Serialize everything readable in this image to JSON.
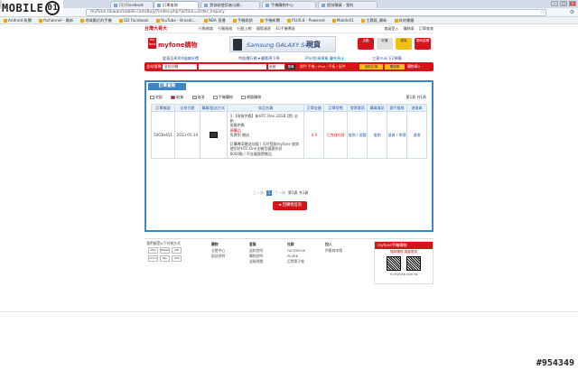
{
  "watermark": {
    "brand": "MOBILE",
    "brand_icon": "01",
    "id": "#954349"
  },
  "browser": {
    "tabs": [
      {
        "label": "Android 新聞中文..."
      },
      {
        "label": "(1) Facebook"
      },
      {
        "label": "訂單查詢"
      },
      {
        "label": "我協助使用者公開..."
      },
      {
        "label": "手機購物中心"
      },
      {
        "label": "提前購買 - 我的"
      }
    ],
    "active_tab": 2,
    "url": "myfone.taiwanmobile.com/buy/?index.php?action=order_inquiry",
    "bookmarks": [
      "Android 新聞",
      "fschannel - 最新",
      "地域最近的手機",
      "GD Facebook",
      "YouTube - Broadc...",
      "NBA 直播",
      "手機熱銷",
      "手機新聞",
      "PLUS.8 - Powered",
      "Mobile01",
      "主題區_最新",
      "其他書籤"
    ],
    "nav": {
      "back": "◀",
      "forward": "▶",
      "reload": "↻",
      "home": "⌂"
    }
  },
  "site": {
    "top_logo": "台灣大哥大",
    "top_links": [
      "行動網路",
      "行動服務",
      "行動上網",
      "國際漫遊",
      "4G手機專區"
    ],
    "top_right": [
      "會員登入",
      "購物車",
      "訂單查詢"
    ],
    "brand_name": "myfone購物",
    "ad": {
      "text": "Samsung GALAXY S4",
      "tag": "現貨"
    },
    "promos": [
      "活動",
      "好康",
      "優惠",
      "限時搶購"
    ],
    "marquee": [
      "愛瘋吾8000抽拿好禮",
      "特殺價行動★優惠現下降",
      "iPad台灣現貨 優先為止",
      "三星mini下2預購"
    ],
    "search": {
      "label": "全站搜尋",
      "category": "全站分類",
      "scope": "全館",
      "go": "搜尋",
      "hot": "熱門 手機 / iPad / 平板 / 配件",
      "btn1": "我的訂單",
      "btn2": "購物車",
      "cart": "購物車0"
    }
  },
  "orders": {
    "title": "訂單查詢",
    "legend": [
      {
        "label": "宅配",
        "color": "#ffffff"
      },
      {
        "label": "取貨",
        "color": "#d4141b"
      },
      {
        "label": "取消",
        "color": "#dddddd"
      },
      {
        "label": "手機購物",
        "color": "#ffffff"
      },
      {
        "label": "網路購物",
        "color": "#ffffff"
      }
    ],
    "page_top": "第1頁 共1頁",
    "columns": [
      "訂單編號",
      "交易日期",
      "購買/配送方式",
      "商品名稱",
      "訂單金額",
      "訂單狀態",
      "發票資訊",
      "購買資訊",
      "客戶服務",
      "退換貨"
    ],
    "rows": [
      {
        "order_no": "5003H451",
        "date": "2013-05-14",
        "product_lines": [
          "1.【現貨供應】新HTC One 32GB (黑) 全新",
          "限量供應",
          "預購品",
          "免費到 贈送",
          "",
          "訂購專案贈送加值 / 可於登錄myfone 查詢",
          "使用於HTC One全機型優惠折扣",
          "8000點 / 不含優惠價贈品"
        ],
        "amount": "$ 0",
        "status": "已完成付款",
        "invoice": "查詢 / 追蹤",
        "buy_info": "查詢",
        "service": "退貨 / 申請",
        "return": "退換"
      }
    ],
    "pager": {
      "prev": "上一頁",
      "current": "1",
      "next": "下一頁",
      "summary": "第1頁 共1頁"
    },
    "back_button": "◄ 回購物首頁"
  },
  "footer": {
    "pay_title": "我們接受以下付款方式",
    "cards": [
      "VISA",
      "Master",
      "JCB",
      "Union",
      "Pay",
      "ATM"
    ],
    "cols": [
      {
        "title": "購物",
        "items": [
          "全館中心",
          "配送說明"
        ]
      },
      {
        "title": "客服",
        "items": [
          "退款說明",
          "購物說明",
          "退貨問題"
        ]
      },
      {
        "title": "社群",
        "items": [
          "FACEBOOK",
          "PLURK",
          "訂閱電子報"
        ]
      },
      {
        "title": "加入",
        "items": [
          "供應商申請"
        ]
      }
    ],
    "mf": {
      "title": "myfone手機購物",
      "sub": "隨時購物 隨處優惠",
      "url": "m.myfone.com.tw"
    }
  }
}
